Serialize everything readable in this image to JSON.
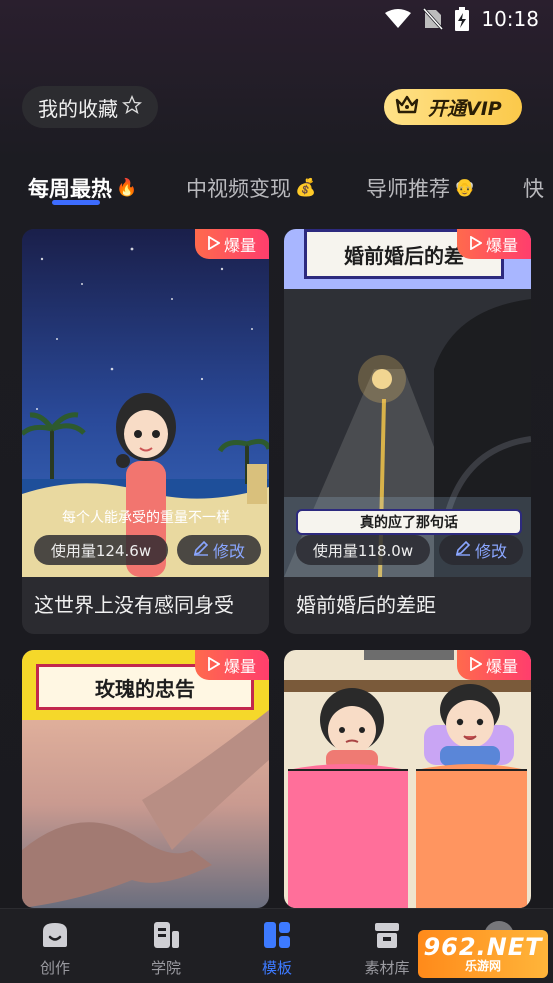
{
  "status_bar": {
    "time": "10:18"
  },
  "header": {
    "favorites_label": "我的收藏",
    "vip_label": "开通VIP"
  },
  "tabs": [
    {
      "label": "每周最热",
      "emoji": "🔥"
    },
    {
      "label": "中视频变现",
      "emoji": "💰"
    },
    {
      "label": "导师推荐",
      "emoji": "👴"
    },
    {
      "label": "快"
    }
  ],
  "cards": [
    {
      "badge": "爆量",
      "usage": "使用量124.6w",
      "edit": "修改",
      "caption": "每个人能承受的重量不一样",
      "title": "这世界上没有感同身受"
    },
    {
      "badge": "爆量",
      "usage": "使用量118.0w",
      "edit": "修改",
      "top_label": "婚前婚后的差",
      "caption": "真的应了那句话",
      "title": "婚前婚后的差距"
    },
    {
      "badge": "爆量",
      "top_label": "玫瑰的忠告"
    },
    {
      "badge": "爆量"
    }
  ],
  "bottom_nav": [
    {
      "label": "创作",
      "icon": "create-icon"
    },
    {
      "label": "学院",
      "icon": "academy-icon"
    },
    {
      "label": "模板",
      "icon": "template-icon",
      "active": true
    },
    {
      "label": "素材库",
      "icon": "store-icon"
    }
  ],
  "watermark": {
    "main": "962.NET",
    "sub": "乐游网"
  },
  "colors": {
    "accent": "#3d7aff",
    "badge": "#ff4a5c",
    "vip": "#fbc94a"
  }
}
